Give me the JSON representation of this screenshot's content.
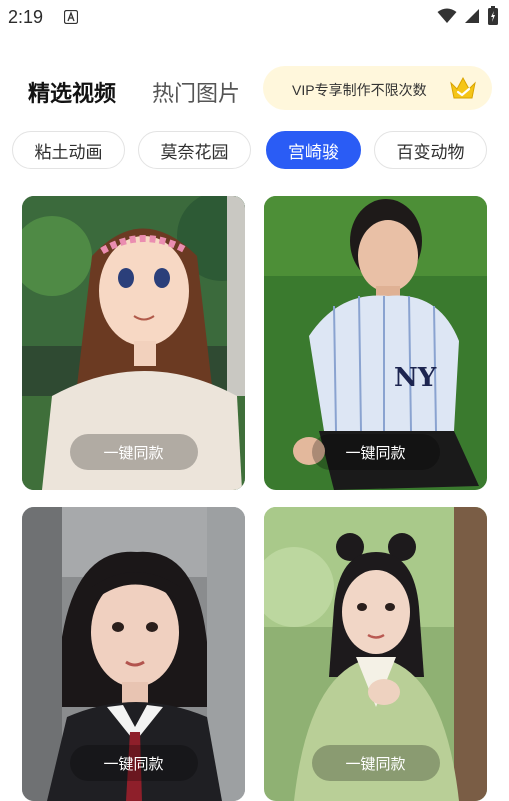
{
  "status_bar": {
    "time": "2:19"
  },
  "tabs": {
    "selected_videos": "精选视频",
    "hot_images": "热门图片"
  },
  "vip_banner": {
    "text": "VIP专享制作不限次数"
  },
  "categories": [
    {
      "label": "粘土动画",
      "active": false
    },
    {
      "label": "莫奈花园",
      "active": false
    },
    {
      "label": "宫崎骏",
      "active": true
    },
    {
      "label": "百变动物",
      "active": false
    }
  ],
  "cards": [
    {
      "button_label": "一键同款"
    },
    {
      "button_label": "一键同款"
    },
    {
      "button_label": "一键同款"
    },
    {
      "button_label": "一键同款"
    }
  ],
  "colors": {
    "accent": "#2a5cf5",
    "vip_bg": "#fff7dc",
    "crown": "#f5c518"
  },
  "icons": [
    "notification-a-icon",
    "wifi-icon",
    "signal-icon",
    "battery-charging-icon",
    "crown-icon"
  ]
}
